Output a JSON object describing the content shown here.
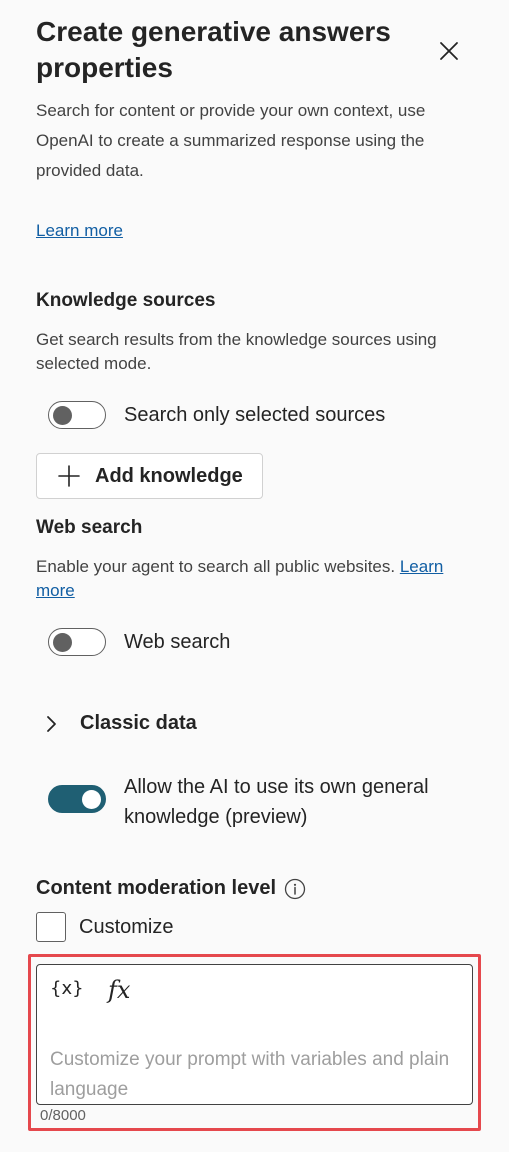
{
  "header": {
    "title": "Create generative answers properties",
    "description": "Search for content or provide your own context, use OpenAI to create a summarized response using the provided data.",
    "learn_more": "Learn more"
  },
  "knowledge": {
    "heading": "Knowledge sources",
    "description": "Get search results from the knowledge sources using selected mode.",
    "toggle_label": "Search only selected sources",
    "toggle_on": false,
    "add_button": "Add knowledge"
  },
  "web_search": {
    "heading": "Web search",
    "description": "Enable your agent to search all public websites.",
    "learn_more": "Learn more",
    "toggle_label": "Web search",
    "toggle_on": false
  },
  "classic": {
    "label": "Classic data"
  },
  "general_knowledge": {
    "toggle_label": "Allow the AI to use its own general knowledge (preview)",
    "toggle_on": true
  },
  "moderation": {
    "heading": "Content moderation level",
    "customize_label": "Customize",
    "customize_checked": false
  },
  "prompt": {
    "variable_button": "{x}",
    "formula_button": "fx",
    "placeholder": "Customize your prompt with variables and plain language",
    "counter": "0/8000"
  },
  "colors": {
    "accent": "#1f5f73",
    "link": "#115ea3",
    "highlight": "#e5484d"
  }
}
